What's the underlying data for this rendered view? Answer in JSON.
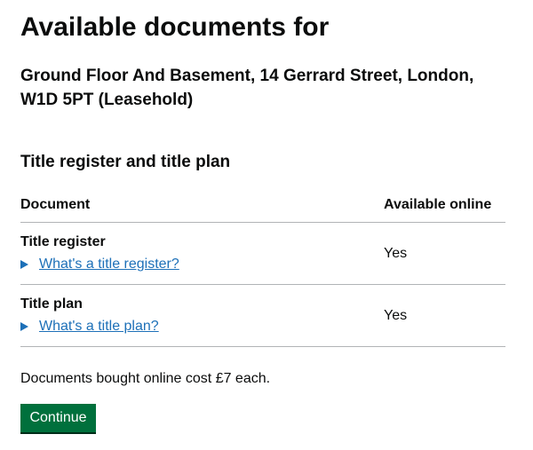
{
  "page": {
    "title": "Available documents for",
    "address": "Ground Floor And Basement, 14 Gerrard Street, London, W1D 5PT (Leasehold)"
  },
  "section": {
    "heading": "Title register and title plan"
  },
  "table": {
    "headers": {
      "document": "Document",
      "available": "Available online"
    },
    "rows": [
      {
        "title": "Title register",
        "help_link": "What's a title register?",
        "available": "Yes"
      },
      {
        "title": "Title plan",
        "help_link": "What's a title plan?",
        "available": "Yes"
      }
    ]
  },
  "cost_note": "Documents bought online cost £7 each.",
  "continue_label": "Continue",
  "colors": {
    "text": "#0b0c0c",
    "link": "#1d70b8",
    "button": "#00703c",
    "divider": "#b1b4b6"
  }
}
